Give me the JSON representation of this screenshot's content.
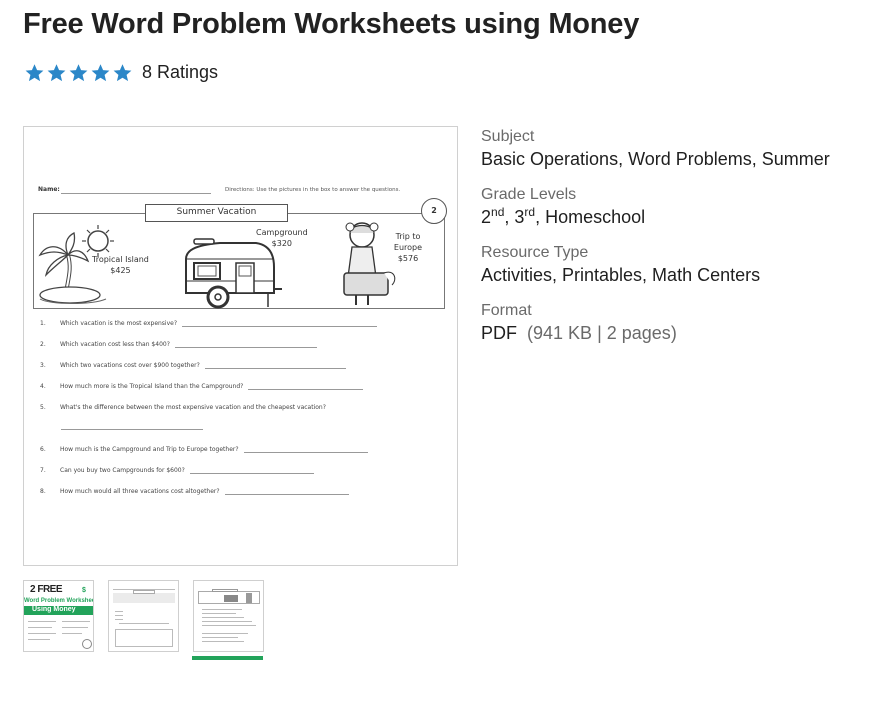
{
  "product": {
    "title": "Free Word Problem Worksheets using Money",
    "rating": {
      "stars": 5,
      "max_stars": 5,
      "count_label": "8 Ratings",
      "star_color": "#2b87c8"
    }
  },
  "preview": {
    "worksheet": {
      "name_label": "Name:",
      "directions": "Directions: Use the pictures in the box to answer the questions.",
      "box_title": "Summer Vacation",
      "page_number": "2",
      "items": [
        {
          "name": "Tropical Island",
          "price": "$425"
        },
        {
          "name": "Campground",
          "price": "$320"
        },
        {
          "name": "Trip to Europe",
          "price": "$576"
        }
      ],
      "questions": [
        {
          "num": "1.",
          "text": "Which vacation is the most expensive?"
        },
        {
          "num": "2.",
          "text": "Which vacation cost less than $400?"
        },
        {
          "num": "3.",
          "text": "Which two vacations cost over $900 together?"
        },
        {
          "num": "4.",
          "text": "How much more is the Tropical Island than the Campground?"
        },
        {
          "num": "5.",
          "text": "What's the difference between the most expensive vacation and the cheapest vacation?"
        },
        {
          "num": "6.",
          "text": "How much is the Campground and Trip to Europe together?"
        },
        {
          "num": "7.",
          "text": "Can you buy two Campgrounds for $600?"
        },
        {
          "num": "8.",
          "text": "How much would all three vacations cost altogether?"
        }
      ]
    },
    "thumbnails": [
      {
        "label": "2 FREE",
        "sub1": "Word Problem Worksheets",
        "sub2": "Using Money",
        "selected": false
      },
      {
        "label": "",
        "selected": false
      },
      {
        "label": "",
        "selected": true
      }
    ],
    "selected_indicator_color": "#22a35a"
  },
  "details": {
    "subject": {
      "label": "Subject",
      "value": "Basic Operations, Word Problems, Summer"
    },
    "grade_levels": {
      "label": "Grade Levels",
      "grades": [
        {
          "num": "2",
          "suffix": "nd"
        },
        {
          "num": "3",
          "suffix": "rd"
        }
      ],
      "extra": "Homeschool"
    },
    "resource_type": {
      "label": "Resource Type",
      "value": "Activities, Printables, Math Centers"
    },
    "format": {
      "label": "Format",
      "value": "PDF",
      "size": "941 KB",
      "pages": "2 pages"
    }
  }
}
